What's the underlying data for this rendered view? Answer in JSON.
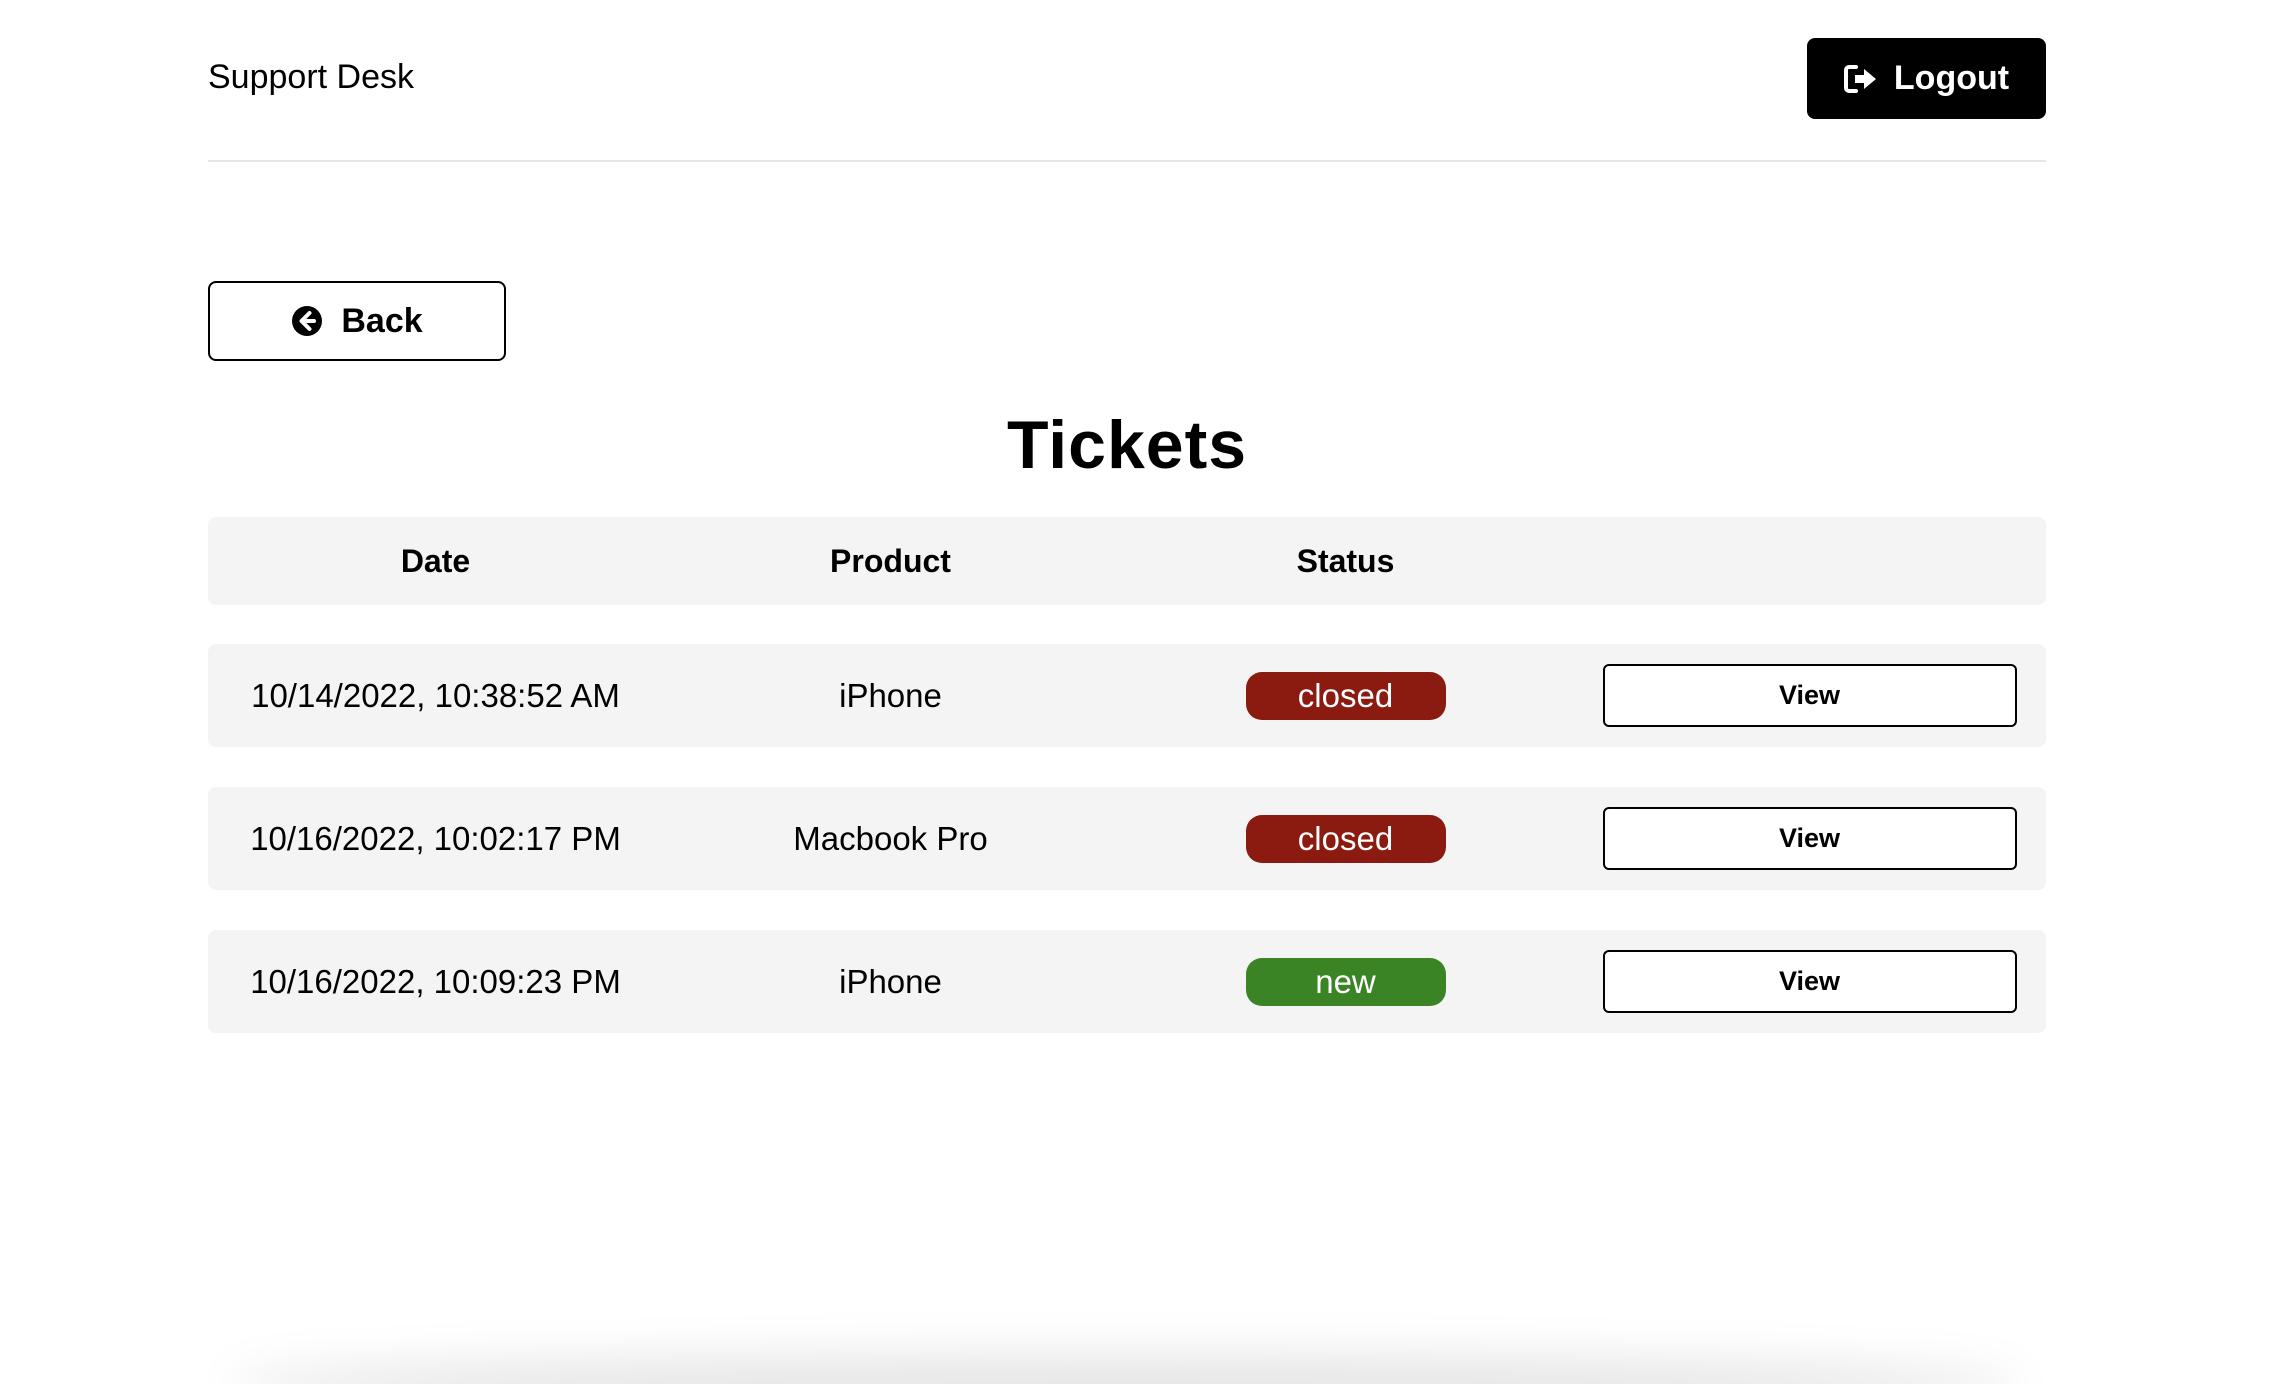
{
  "header": {
    "brand": "Support Desk",
    "logout_label": "Logout",
    "logout_icon": "sign-out-icon"
  },
  "back_button": {
    "label": "Back",
    "icon": "arrow-circle-left-icon"
  },
  "page_title": "Tickets",
  "table": {
    "headers": [
      "Date",
      "Product",
      "Status",
      ""
    ],
    "rows": [
      {
        "date": "10/14/2022, 10:38:52 AM",
        "product": "iPhone",
        "status": "closed",
        "action": "View"
      },
      {
        "date": "10/16/2022, 10:02:17 PM",
        "product": "Macbook Pro",
        "status": "closed",
        "action": "View"
      },
      {
        "date": "10/16/2022, 10:09:23 PM",
        "product": "iPhone",
        "status": "new",
        "action": "View"
      }
    ]
  },
  "colors": {
    "status_closed": "#8b1a10",
    "status_new": "#3a8426",
    "row_background": "#f4f4f4",
    "logout_background": "#000000"
  }
}
